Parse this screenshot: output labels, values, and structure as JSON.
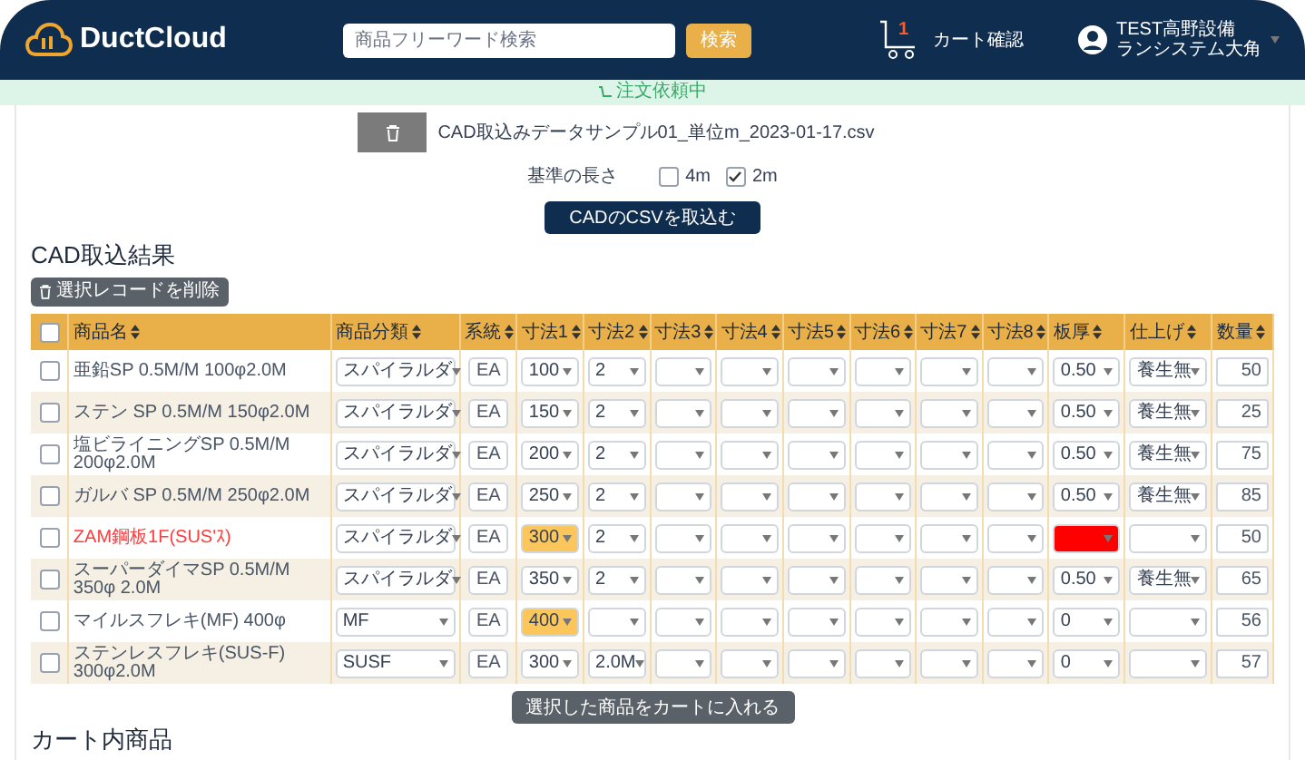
{
  "header": {
    "logo": "DuctCloud",
    "search": {
      "placeholder": "商品フリーワード検索"
    },
    "search_button": "検索",
    "cart": {
      "badge": "1",
      "label": "カート確認"
    },
    "user": [
      "TEST高野設備",
      "ランシステム大角"
    ]
  },
  "status_banner": "注文依頼中",
  "file": {
    "name": "CAD取込みデータサンプル01_単位m_2023-01-17.csv"
  },
  "length": {
    "label": "基準の長さ",
    "options": [
      {
        "label": "4m",
        "checked": false
      },
      {
        "label": "2m",
        "checked": true
      }
    ]
  },
  "import_button": "CADのCSVを取込む",
  "section_title": "CAD取込結果",
  "delete_button": "選択レコードを削除",
  "table": {
    "select_all_checked": false,
    "columns": [
      "商品名",
      "商品分類",
      "系統",
      "寸法1",
      "寸法2",
      "寸法3",
      "寸法4",
      "寸法5",
      "寸法6",
      "寸法7",
      "寸法8",
      "板厚",
      "仕上げ",
      "数量"
    ],
    "rows": [
      {
        "checked": false,
        "error": false,
        "name": "亜鉛SP 0.5M/M 100φ2.0M",
        "category": "スパイラルダ",
        "system": "EA",
        "dims": [
          {
            "value": "100",
            "highlighted": false
          },
          {
            "value": "2",
            "highlighted": false
          },
          {
            "highlighted": false
          },
          {
            "highlighted": false
          },
          {
            "highlighted": false
          },
          {
            "highlighted": false
          },
          {
            "highlighted": false
          },
          {
            "highlighted": false
          }
        ],
        "thickness": {
          "value": "0.50",
          "error": false
        },
        "finish": {
          "value": "養生無"
        },
        "quantity": "50"
      },
      {
        "checked": false,
        "error": false,
        "name": "ステン SP 0.5M/M 150φ2.0M",
        "category": "スパイラルダ",
        "system": "EA",
        "dims": [
          {
            "value": "150",
            "highlighted": false
          },
          {
            "value": "2",
            "highlighted": false
          },
          {
            "highlighted": false
          },
          {
            "highlighted": false
          },
          {
            "highlighted": false
          },
          {
            "highlighted": false
          },
          {
            "highlighted": false
          },
          {
            "highlighted": false
          }
        ],
        "thickness": {
          "value": "0.50",
          "error": false
        },
        "finish": {
          "value": "養生無"
        },
        "quantity": "25"
      },
      {
        "checked": false,
        "error": false,
        "name": "塩ビライニングSP 0.5M/M 200φ2.0M",
        "category": "スパイラルダ",
        "system": "EA",
        "dims": [
          {
            "value": "200",
            "highlighted": false
          },
          {
            "value": "2",
            "highlighted": false
          },
          {
            "highlighted": false
          },
          {
            "highlighted": false
          },
          {
            "highlighted": false
          },
          {
            "highlighted": false
          },
          {
            "highlighted": false
          },
          {
            "highlighted": false
          }
        ],
        "thickness": {
          "value": "0.50",
          "error": false
        },
        "finish": {
          "value": "養生無"
        },
        "quantity": "75"
      },
      {
        "checked": false,
        "error": false,
        "name": "ガルバ SP 0.5M/M 250φ2.0M",
        "category": "スパイラルダ",
        "system": "EA",
        "dims": [
          {
            "value": "250",
            "highlighted": false
          },
          {
            "value": "2",
            "highlighted": false
          },
          {
            "highlighted": false
          },
          {
            "highlighted": false
          },
          {
            "highlighted": false
          },
          {
            "highlighted": false
          },
          {
            "highlighted": false
          },
          {
            "highlighted": false
          }
        ],
        "thickness": {
          "value": "0.50",
          "error": false
        },
        "finish": {
          "value": "養生無"
        },
        "quantity": "85"
      },
      {
        "checked": false,
        "error": true,
        "name": "ZAM鋼板1F(SUS'ｽ)",
        "category": "スパイラルダ",
        "system": "EA",
        "dims": [
          {
            "value": "300",
            "highlighted": true
          },
          {
            "value": "2",
            "highlighted": false
          },
          {
            "highlighted": false
          },
          {
            "highlighted": false
          },
          {
            "highlighted": false
          },
          {
            "highlighted": false
          },
          {
            "highlighted": false
          },
          {
            "highlighted": false
          }
        ],
        "thickness": {
          "error": true
        },
        "finish": {},
        "quantity": "50"
      },
      {
        "checked": false,
        "error": false,
        "name": "スーパーダイマSP 0.5M/M 350φ 2.0M",
        "category": "スパイラルダ",
        "system": "EA",
        "dims": [
          {
            "value": "350",
            "highlighted": false
          },
          {
            "value": "2",
            "highlighted": false
          },
          {
            "highlighted": false
          },
          {
            "highlighted": false
          },
          {
            "highlighted": false
          },
          {
            "highlighted": false
          },
          {
            "highlighted": false
          },
          {
            "highlighted": false
          }
        ],
        "thickness": {
          "value": "0.50",
          "error": false
        },
        "finish": {
          "value": "養生無"
        },
        "quantity": "65"
      },
      {
        "checked": false,
        "error": false,
        "name": "マイルスフレキ(MF) 400φ",
        "category": "MF",
        "system": "EA",
        "dims": [
          {
            "value": "400",
            "highlighted": true
          },
          {
            "highlighted": false
          },
          {
            "highlighted": false
          },
          {
            "highlighted": false
          },
          {
            "highlighted": false
          },
          {
            "highlighted": false
          },
          {
            "highlighted": false
          },
          {
            "highlighted": false
          }
        ],
        "thickness": {
          "value": "0",
          "error": false
        },
        "finish": {},
        "quantity": "56"
      },
      {
        "checked": false,
        "error": false,
        "name": "ステンレスフレキ(SUS-F) 300φ2.0M",
        "category": "SUSF",
        "system": "EA",
        "dims": [
          {
            "value": "300",
            "highlighted": false
          },
          {
            "value": "2.0M",
            "highlighted": false
          },
          {
            "highlighted": false
          },
          {
            "highlighted": false
          },
          {
            "highlighted": false
          },
          {
            "highlighted": false
          },
          {
            "highlighted": false
          },
          {
            "highlighted": false
          }
        ],
        "thickness": {
          "value": "0",
          "error": false
        },
        "finish": {},
        "quantity": "57"
      }
    ]
  },
  "cart_button": "選択した商品をカートに入れる",
  "cart_title": "カート内商品"
}
